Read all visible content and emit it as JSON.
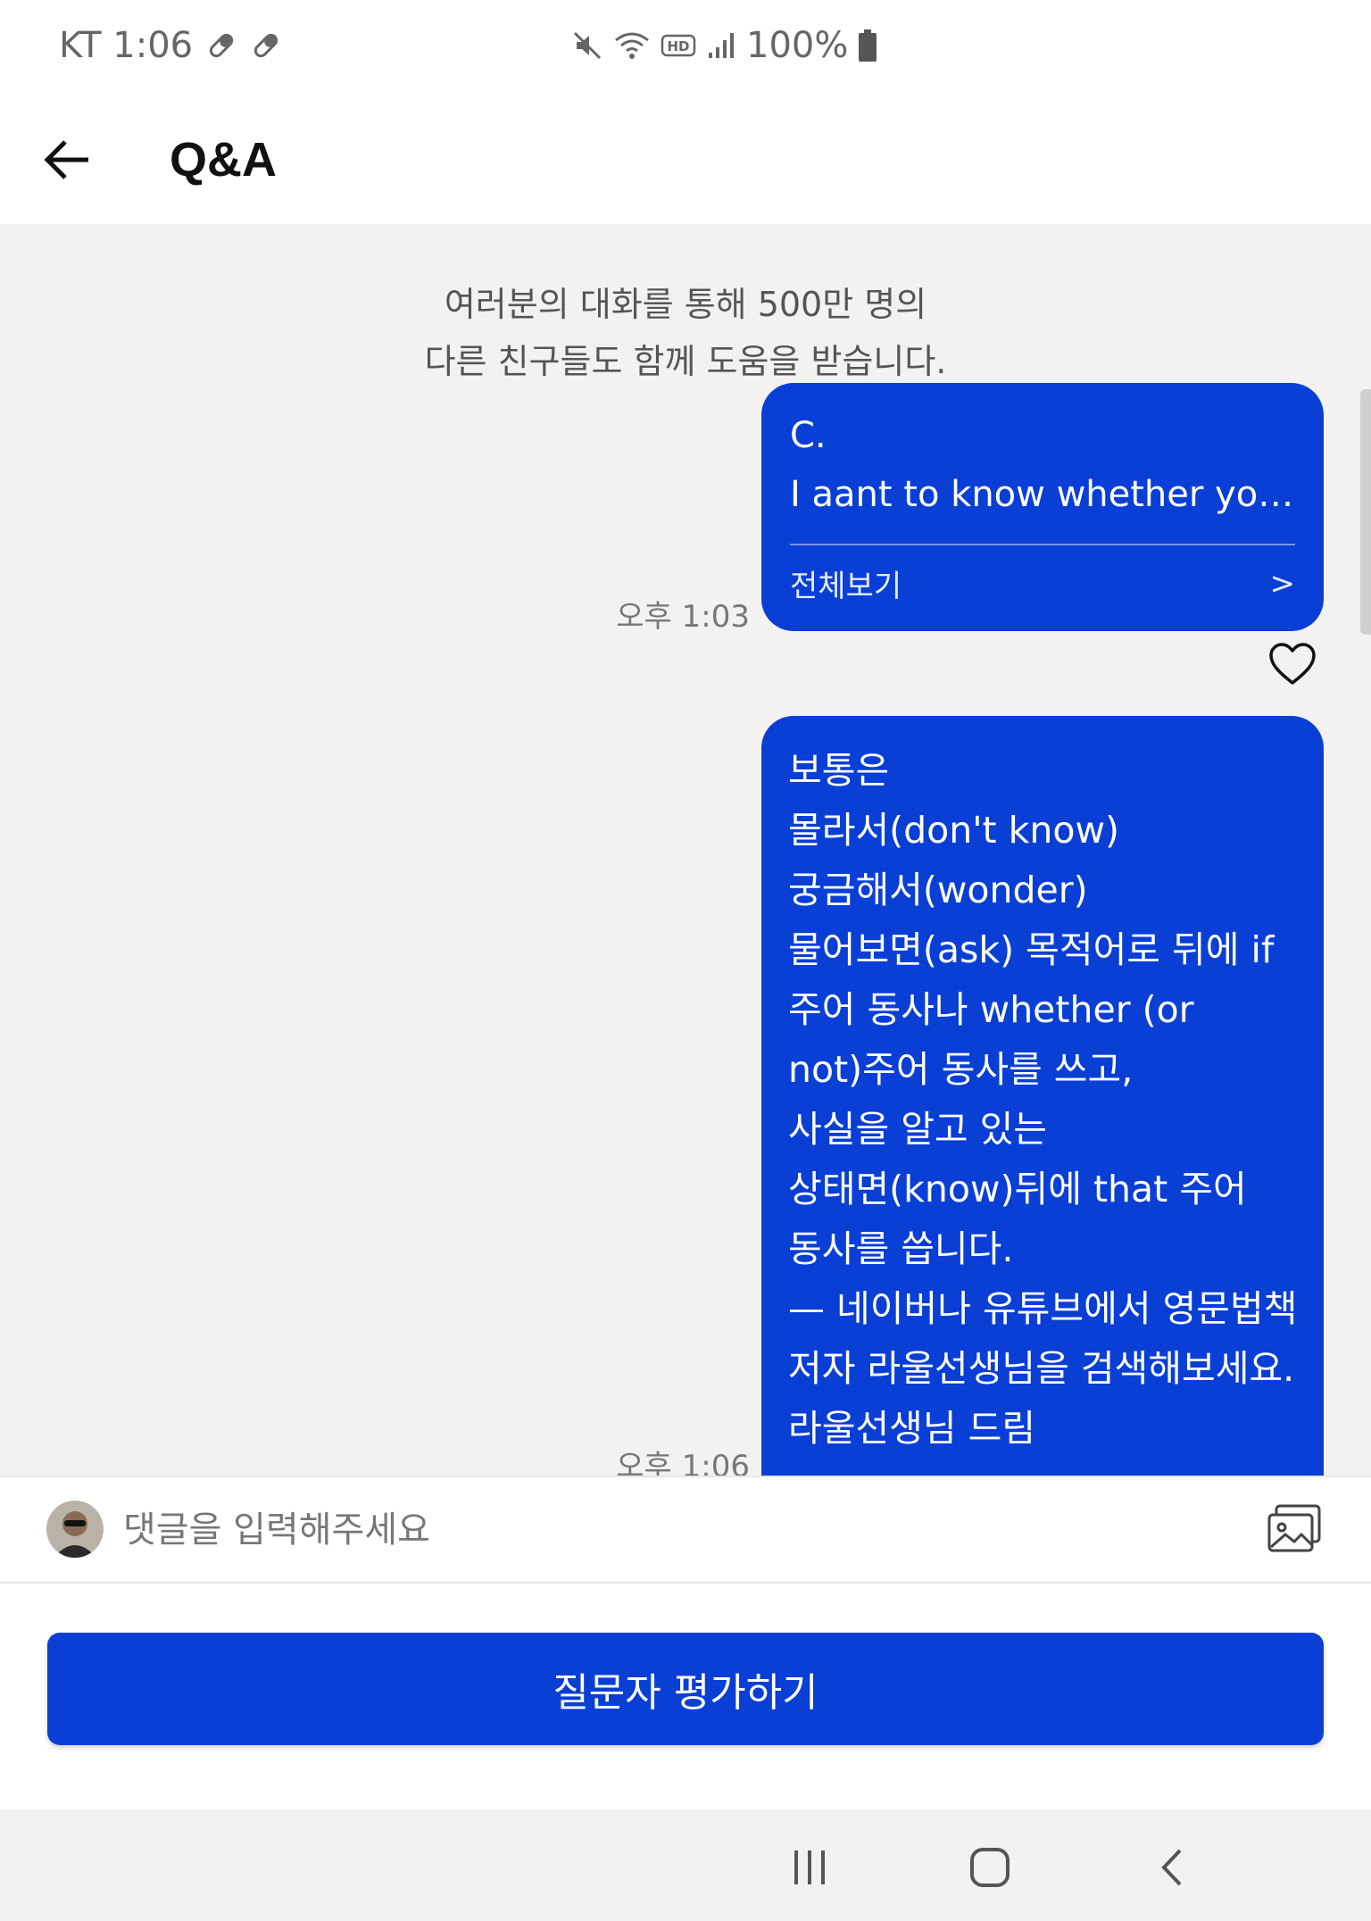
{
  "status_bar": {
    "carrier_time": "KT 1:06",
    "battery": "100%",
    "icons": [
      "pill-icon",
      "pill-icon",
      "mute-icon",
      "wifi-icon",
      "hd-icon",
      "signal-icon",
      "battery-icon"
    ]
  },
  "header": {
    "title": "Q&A",
    "back_icon": "arrow-left-icon"
  },
  "chat": {
    "notice_line1": "여러분의 대화를 통해 500만 명의",
    "notice_line2": "다른 친구들도 함께 도움을 받습니다.",
    "messages": [
      {
        "lines": [
          "C.",
          "I aant to know whether you..."
        ],
        "more_label": "전체보기",
        "more_arrow": ">",
        "time": "오후 1:03",
        "liked": false
      },
      {
        "lines": [
          "보통은",
          "몰라서(don't know)",
          "궁금해서(wonder)",
          "물어보면(ask) 목적어로 뒤에 if",
          "주어 동사나 whether (or",
          "not)주어 동사를 쓰고,",
          "사실을 알고 있는",
          "상태면(know)뒤에 that 주어",
          "동사를 씁니다.",
          "— 네이버나 유튜브에서 영문법책",
          "저자 라울선생님을 검색해보세요.",
          "라울선생님 드림"
        ],
        "time": "오후 1:06"
      }
    ]
  },
  "composer": {
    "placeholder": "댓글을 입력해주세요",
    "image_icon": "image-gallery-icon"
  },
  "actions": {
    "rate_label": "질문자 평가하기"
  },
  "nav": {
    "recents_icon": "recents-icon",
    "home_icon": "home-icon",
    "back_icon": "back-chevron-icon"
  },
  "colors": {
    "accent": "#0a3fd6",
    "background": "#f3f2f1"
  }
}
